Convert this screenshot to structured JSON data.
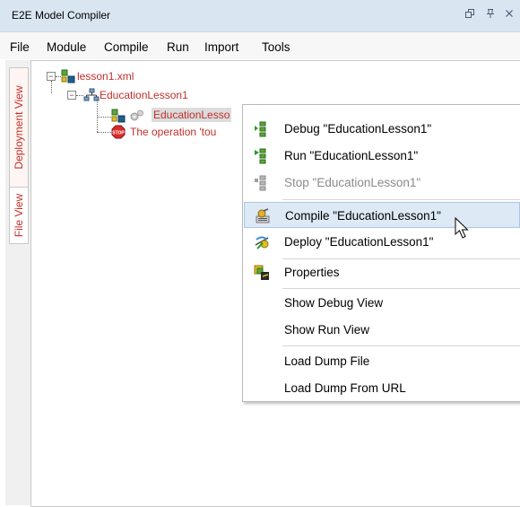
{
  "window": {
    "title": "E2E Model Compiler",
    "controls": [
      "restore",
      "pin",
      "close"
    ]
  },
  "menubar": {
    "items": [
      "File",
      "Module",
      "Compile",
      "Run",
      "Import",
      "Tools"
    ]
  },
  "side_tabs": {
    "deployment": "Deployment View",
    "file": "File View"
  },
  "tree": {
    "root": "lesson1.xml",
    "child": "EducationLesson1",
    "grandchild": "EducationLesso",
    "error": "The operation 'tou"
  },
  "context_menu": {
    "items": [
      {
        "label": "Debug \"EducationLesson1\"",
        "icon": "debug-icon",
        "enabled": true
      },
      {
        "label": "Run \"EducationLesson1\"",
        "icon": "run-icon",
        "enabled": true
      },
      {
        "label": "Stop \"EducationLesson1\"",
        "icon": "stop-icon",
        "enabled": false
      },
      {
        "label": "Compile \"EducationLesson1\"",
        "icon": "compile-icon",
        "enabled": true,
        "hovered": true
      },
      {
        "label": "Deploy \"EducationLesson1\"",
        "icon": "deploy-icon",
        "enabled": true
      },
      {
        "label": "Properties",
        "icon": "properties-icon",
        "enabled": true
      },
      {
        "label": "Show Debug View",
        "enabled": true
      },
      {
        "label": "Show Run View",
        "enabled": true
      },
      {
        "label": "Load Dump File",
        "enabled": true
      },
      {
        "label": "Load Dump From URL",
        "enabled": true
      }
    ]
  },
  "colors": {
    "tree_text": "#c0302b",
    "titlebar": "#dae5f2",
    "hover": "#dde9f5"
  }
}
